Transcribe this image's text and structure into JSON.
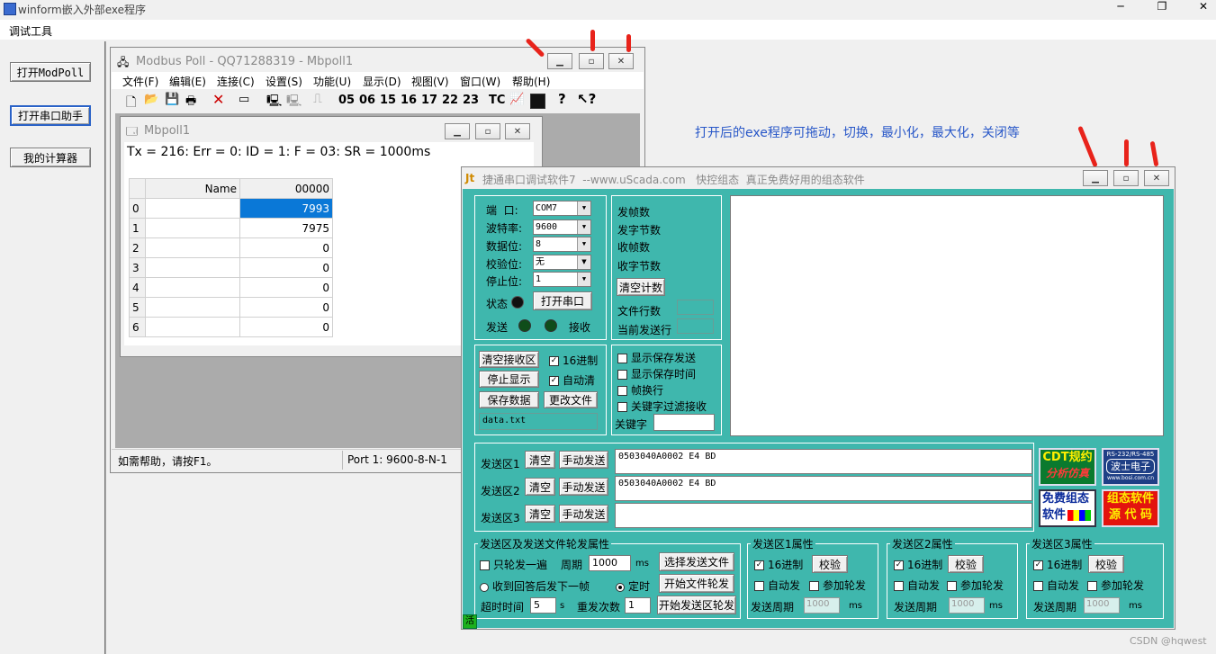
{
  "main_window": {
    "title": "winform嵌入外部exe程序",
    "menu": [
      "调试工具"
    ],
    "buttons": [
      "打开ModPoll",
      "打开串口助手",
      "我的计算器"
    ]
  },
  "modbus": {
    "title": "Modbus Poll - QQ71288319 - Mbpoll1",
    "menu": [
      "文件(F)",
      "编辑(E)",
      "连接(C)",
      "设置(S)",
      "功能(U)",
      "显示(D)",
      "视图(V)",
      "窗口(W)",
      "帮助(H)"
    ],
    "toolbar_codes": [
      "05",
      "06",
      "15",
      "16",
      "17",
      "22",
      "23",
      "TC"
    ],
    "child_title": "Mbpoll1",
    "status_line": "Tx = 216: Err = 0: ID = 1: F = 03: SR = 1000ms",
    "grid_headers": [
      "Name",
      "00000"
    ],
    "rows": [
      {
        "idx": "0",
        "value": "7993"
      },
      {
        "idx": "1",
        "value": "7975"
      },
      {
        "idx": "2",
        "value": "0"
      },
      {
        "idx": "3",
        "value": "0"
      },
      {
        "idx": "4",
        "value": "0"
      },
      {
        "idx": "5",
        "value": "0"
      },
      {
        "idx": "6",
        "value": "0"
      }
    ],
    "statusbar_help": "如需帮助，请按F1。",
    "statusbar_port": "Port 1: 9600-8-N-1"
  },
  "annotation": "打开后的exe程序可拖动，切换，最小化，最大化，关闭等",
  "serial": {
    "title": "捷通串口调试软件7  --www.uScada.com   快控组态  真正免费好用的组态软件",
    "port_label": "端  口:",
    "port_value": "COM7",
    "baud_label": "波特率:",
    "baud_value": "9600",
    "data_label": "数据位:",
    "data_value": "8",
    "parity_label": "校验位:",
    "parity_value": "无",
    "stop_label": "停止位:",
    "stop_value": "1",
    "state_label": "状态",
    "open_port": "打开串口",
    "send_label": "发送",
    "recv_label": "接收",
    "counters": [
      "发帧数",
      "发字节数",
      "收帧数",
      "收字节数"
    ],
    "clear_count": "清空计数",
    "file_rows": "文件行数",
    "cur_row": "当前发送行",
    "clear_recv": "清空接收区",
    "hex16": "16进制",
    "stop_display": "停止显示",
    "auto_clear": "自动清",
    "save_data": "保存数据",
    "change_file": "更改文件",
    "filename": "data.txt",
    "show_save_send": "显示保存发送",
    "show_save_time": "显示保存时间",
    "frame_newline": "帧换行",
    "kw_filter": "关键字过滤接收",
    "keyword": "关键字",
    "send_areas": [
      {
        "label": "发送区1",
        "text": "0503040A0002 E4 BD"
      },
      {
        "label": "发送区2",
        "text": "0503040A0002 E4 BD"
      },
      {
        "label": "发送区3",
        "text": ""
      }
    ],
    "clear": "清空",
    "manual_send": "手动发送",
    "ad1_top": "CDT规约",
    "ad1_bot": "分析仿真",
    "ad2_top": "RS-232/RS-485",
    "ad2_mid": "波士电子",
    "ad2_bot": "www.bosi.com.cn",
    "ad3_top": "免费组态",
    "ad3_bot": "软件",
    "ad4_top": "组态软件",
    "ad4_bot": "源 代 码",
    "rotation_group": "发送区及发送文件轮发属性",
    "only_once": "只轮发一遍",
    "period": "周期",
    "period_value": "1000",
    "ms": "ms",
    "select_file": "选择发送文件",
    "reply_next": "收到回答后发下一帧",
    "timed": "定时",
    "start_file_rotation": "开始文件轮发",
    "timeout": "超时时间",
    "timeout_value": "5",
    "s": "s",
    "retry": "重发次数",
    "retry_value": "1",
    "start_area_rotation": "开始发送区轮发",
    "area_props": [
      {
        "title": "发送区1属性"
      },
      {
        "title": "发送区2属性"
      },
      {
        "title": "发送区3属性"
      }
    ],
    "verify": "校验",
    "auto_send": "自动发",
    "join_rotation": "参加轮发",
    "send_period": "发送周期",
    "send_period_value": "1000",
    "status_corner": "活"
  },
  "watermark": "CSDN @hqwest"
}
